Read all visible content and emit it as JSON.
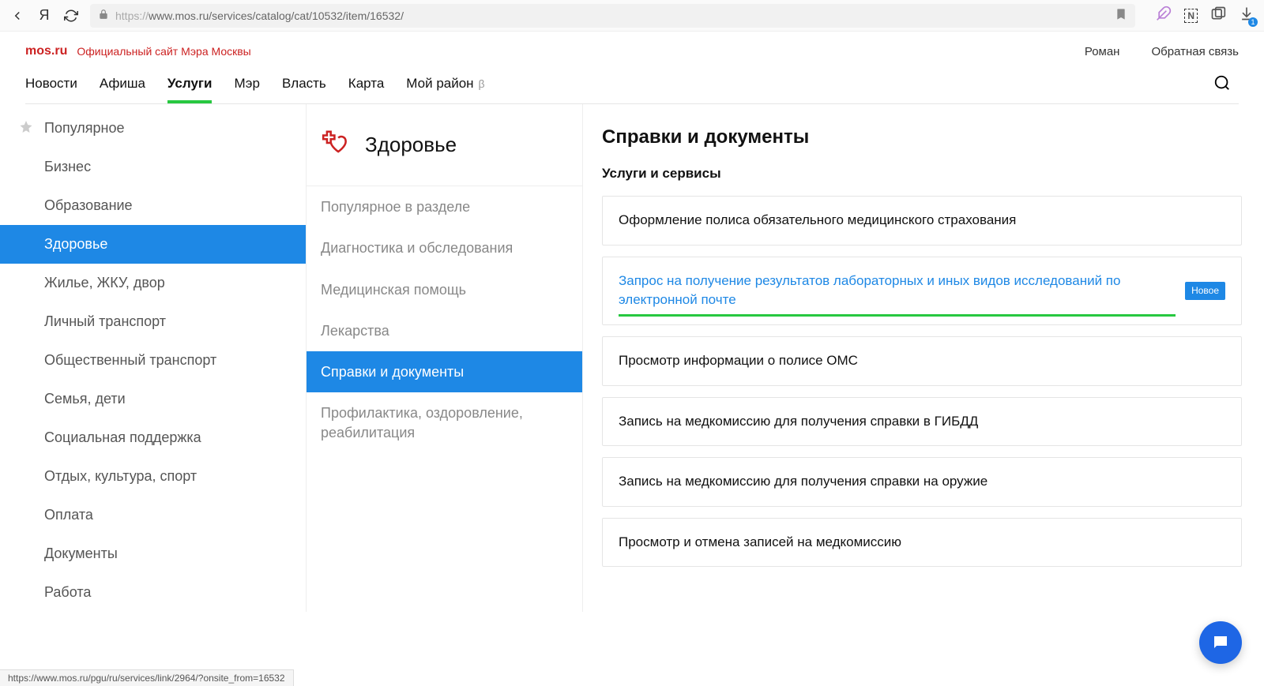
{
  "browser": {
    "url_scheme": "https://",
    "url_rest": "www.mos.ru/services/catalog/cat/10532/item/16532/"
  },
  "site": {
    "logo": "mos.ru",
    "tagline": "Официальный сайт Мэра Москвы",
    "username": "Роман",
    "feedback": "Обратная связь"
  },
  "nav": {
    "items": [
      {
        "label": "Новости"
      },
      {
        "label": "Афиша"
      },
      {
        "label": "Услуги",
        "active": true
      },
      {
        "label": "Мэр"
      },
      {
        "label": "Власть"
      },
      {
        "label": "Карта"
      },
      {
        "label": "Мой район",
        "beta": "β"
      }
    ]
  },
  "sidebar": {
    "items": [
      {
        "label": "Популярное",
        "star": true
      },
      {
        "label": "Бизнес"
      },
      {
        "label": "Образование"
      },
      {
        "label": "Здоровье",
        "active": true
      },
      {
        "label": "Жилье, ЖКУ, двор"
      },
      {
        "label": "Личный транспорт"
      },
      {
        "label": "Общественный транспорт"
      },
      {
        "label": "Семья, дети"
      },
      {
        "label": "Социальная поддержка"
      },
      {
        "label": "Отдых, культура, спорт"
      },
      {
        "label": "Оплата"
      },
      {
        "label": "Документы"
      },
      {
        "label": "Работа"
      }
    ]
  },
  "midcol": {
    "title": "Здоровье",
    "items": [
      {
        "label": "Популярное в разделе"
      },
      {
        "label": "Диагностика и обследования"
      },
      {
        "label": "Медицинская помощь"
      },
      {
        "label": "Лекарства"
      },
      {
        "label": "Справки и документы",
        "active": true
      },
      {
        "label": "Профилактика, оздоровление, реабилитация"
      }
    ]
  },
  "content": {
    "title": "Справки и документы",
    "subtitle": "Услуги и сервисы",
    "services": [
      {
        "label": "Оформление полиса обязательного медицинского страхования"
      },
      {
        "label": "Запрос на получение результатов лабораторных и иных видов исследований по электронной почте",
        "highlight": true,
        "badge": "Новое"
      },
      {
        "label": "Просмотр информации о полисе ОМС"
      },
      {
        "label": "Запись на медкомиссию для получения справки в ГИБДД"
      },
      {
        "label": "Запись на медкомиссию для получения справки на оружие"
      },
      {
        "label": "Просмотр и отмена записей на медкомиссию"
      }
    ]
  },
  "status_url": "https://www.mos.ru/pgu/ru/services/link/2964/?onsite_from=16532"
}
